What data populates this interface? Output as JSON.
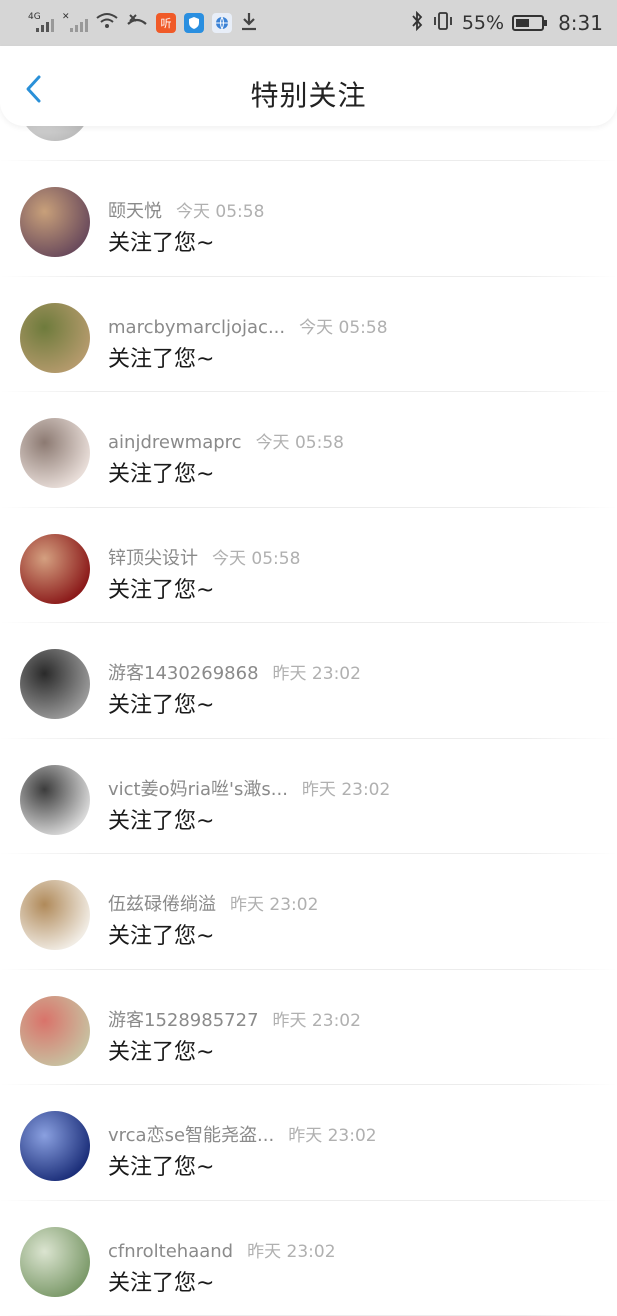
{
  "status_bar": {
    "network_tag": "4G",
    "battery": "55%",
    "battery_level": 0.55,
    "time": "8:31",
    "icons": [
      "signal-icon",
      "signal-x-icon",
      "wifi-icon",
      "missed-call-icon",
      "listen-app-icon",
      "shield-app-icon",
      "browser-app-icon",
      "download-icon",
      "bluetooth-icon",
      "vibrate-icon",
      "battery-icon"
    ]
  },
  "header": {
    "title": "特别关注"
  },
  "list": {
    "items": [
      {
        "name": "颐天悦",
        "time": "今天 05:58",
        "message": "关注了您~",
        "avatar_colors": [
          "#6b4b5c",
          "#c8a07a"
        ]
      },
      {
        "name": "marcbymarcljojac...",
        "time": "今天 05:58",
        "message": "关注了您~",
        "avatar_colors": [
          "#b49a6c",
          "#6e7b3c"
        ]
      },
      {
        "name": "ainjdrewmaprc",
        "time": "今天 05:58",
        "message": "关注了您~",
        "avatar_colors": [
          "#e8ddd8",
          "#8c7a72"
        ]
      },
      {
        "name": "锌顶尖设计",
        "time": "今天 05:58",
        "message": "关注了您~",
        "avatar_colors": [
          "#8b1a1a",
          "#d4a080"
        ]
      },
      {
        "name": "游客1430269868",
        "time": "昨天 23:02",
        "message": "关注了您~",
        "avatar_colors": [
          "#9a9a9a",
          "#2a2a2a"
        ]
      },
      {
        "name": "vict姜o妈ria咝's澉s...",
        "time": "昨天 23:02",
        "message": "关注了您~",
        "avatar_colors": [
          "#d8d8d8",
          "#3c3c3c"
        ]
      },
      {
        "name": "伍兹碌倦绱溢",
        "time": "昨天 23:02",
        "message": "关注了您~",
        "avatar_colors": [
          "#f1ece4",
          "#b08a5a"
        ]
      },
      {
        "name": "游客1528985727",
        "time": "昨天 23:02",
        "message": "关注了您~",
        "avatar_colors": [
          "#c8c0a0",
          "#d9736a"
        ]
      },
      {
        "name": "vrca恋se智能尧盗...",
        "time": "昨天 23:02",
        "message": "关注了您~",
        "avatar_colors": [
          "#1c2f7a",
          "#8aa0e0"
        ]
      },
      {
        "name": "cfnroltehaand",
        "time": "昨天 23:02",
        "message": "关注了您~",
        "avatar_colors": [
          "#7c9a6a",
          "#dbe4d0"
        ]
      }
    ]
  }
}
